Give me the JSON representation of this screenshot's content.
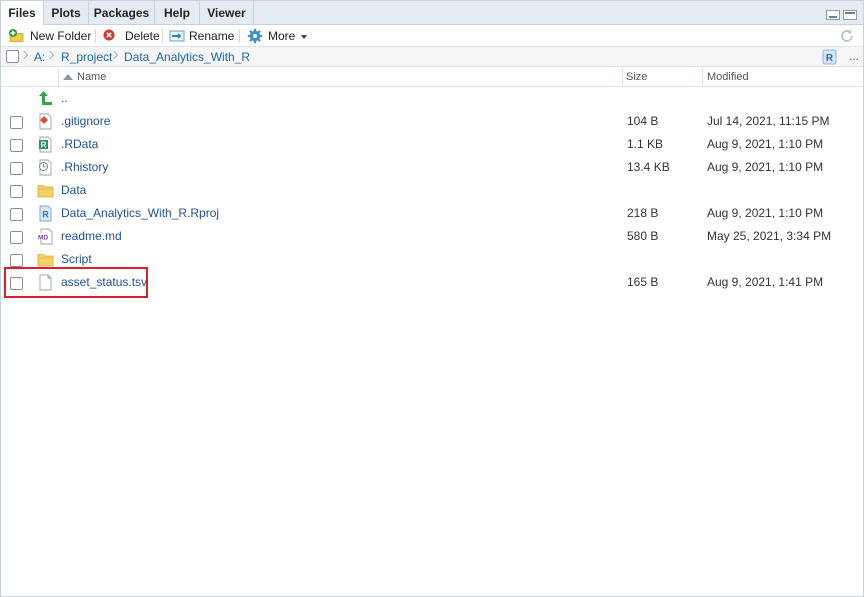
{
  "tabs": [
    {
      "label": "Files",
      "active": true
    },
    {
      "label": "Plots",
      "active": false
    },
    {
      "label": "Packages",
      "active": false
    },
    {
      "label": "Help",
      "active": false
    },
    {
      "label": "Viewer",
      "active": false
    }
  ],
  "toolbar": {
    "new_folder": "New Folder",
    "delete": "Delete",
    "rename": "Rename",
    "more": "More"
  },
  "breadcrumb": [
    "A:",
    "R_project",
    "Data_Analytics_With_R"
  ],
  "breadcrumb_more": "...",
  "columns": {
    "name": "Name",
    "size": "Size",
    "modified": "Modified"
  },
  "parent_dir_label": "..",
  "files": [
    {
      "name": ".gitignore",
      "size": "104 B",
      "modified": "Jul 14, 2021, 11:15 PM",
      "icon": "gitignore-file-icon"
    },
    {
      "name": ".RData",
      "size": "1.1 KB",
      "modified": "Aug 9, 2021, 1:10 PM",
      "icon": "rdata-file-icon"
    },
    {
      "name": ".Rhistory",
      "size": "13.4 KB",
      "modified": "Aug 9, 2021, 1:10 PM",
      "icon": "rhistory-file-icon"
    },
    {
      "name": "Data",
      "size": "",
      "modified": "",
      "icon": "folder-icon"
    },
    {
      "name": "Data_Analytics_With_R.Rproj",
      "size": "218 B",
      "modified": "Aug 9, 2021, 1:10 PM",
      "icon": "rproj-file-icon"
    },
    {
      "name": "readme.md",
      "size": "580 B",
      "modified": "May 25, 2021, 3:34 PM",
      "icon": "markdown-file-icon"
    },
    {
      "name": "Script",
      "size": "",
      "modified": "",
      "icon": "folder-icon"
    },
    {
      "name": "asset_status.tsv",
      "size": "165 B",
      "modified": "Aug 9, 2021, 1:41 PM",
      "icon": "text-file-icon"
    }
  ],
  "colors": {
    "highlight": "#d9202a",
    "link": "#1e4f9c",
    "tabbar": "#e4ebf2"
  }
}
